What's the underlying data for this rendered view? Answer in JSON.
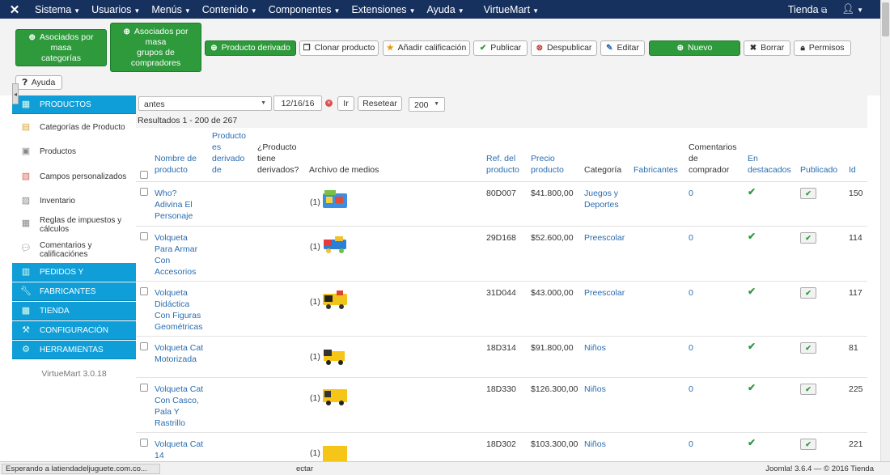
{
  "topnav": {
    "logo": "✕",
    "menus": [
      "Sistema",
      "Usuarios",
      "Menús",
      "Contenido",
      "Componentes",
      "Extensiones",
      "Ayuda"
    ],
    "virtuemart": "VirtueMart",
    "store": "Tienda",
    "user_icon": "user-icon"
  },
  "toolbar": {
    "mass_categories": [
      "Asociados por",
      "masa",
      "categorías"
    ],
    "mass_groups": [
      "Asociados por",
      "masa",
      "grupos de",
      "compradores"
    ],
    "derived": "Producto derivado",
    "clone": "Clonar producto",
    "rating": "Añadir calificación",
    "publish": "Publicar",
    "unpublish": "Despublicar",
    "edit": "Editar",
    "new": "Nuevo",
    "delete": "Borrar",
    "permissions": "Permisos",
    "help": "Ayuda"
  },
  "sidebar": {
    "products_header": "PRODUCTOS",
    "items": [
      "Categorías de Producto",
      "Productos",
      "Campos personalizados",
      "Inventario",
      "Reglas de impuestos y cálculos",
      "Comentarios y calificaciónes"
    ],
    "sections": [
      "PEDIDOS Y",
      "FABRICANTES",
      "TIENDA",
      "CONFIGURACIÓN",
      "HERRAMIENTAS"
    ],
    "version": "VirtueMart 3.0.18"
  },
  "filters": {
    "date_mode": "antes",
    "date_value": "12/16/16",
    "go": "Ir",
    "reset": "Resetear",
    "limit": "200"
  },
  "results": "Resultados 1 - 200 de 267",
  "table": {
    "headers": {
      "name": [
        "Nombre de",
        "producto"
      ],
      "derived_of": [
        "Producto",
        "es",
        "derivado",
        "de"
      ],
      "has_derived": [
        "¿Producto",
        "tiene",
        "derivados?"
      ],
      "media": "Archivo de medios",
      "sku": [
        "Ref. del",
        "producto"
      ],
      "price": [
        "Precio",
        "producto"
      ],
      "category": "Categoría",
      "manufacturers": "Fabricantes",
      "comments": [
        "Comentarios",
        "de",
        "comprador"
      ],
      "featured": [
        "En",
        "destacados"
      ],
      "published": "Publicado",
      "id": "Id"
    },
    "rows": [
      {
        "name": [
          "Who?",
          "Adivina El",
          "Personaje"
        ],
        "media": "(1)",
        "sku": "80D007",
        "price": "$41.800,00",
        "category": [
          "Juegos y",
          "Deportes"
        ],
        "comments": "0",
        "id": "150"
      },
      {
        "name": [
          "Volqueta",
          "Para Armar",
          "Con",
          "Accesorios"
        ],
        "media": "(1)",
        "sku": "29D168",
        "price": "$52.600,00",
        "category": [
          "Preescolar"
        ],
        "comments": "0",
        "id": "114"
      },
      {
        "name": [
          "Volqueta",
          "Didáctica",
          "Con Figuras",
          "Geométricas"
        ],
        "media": "(1)",
        "sku": "31D044",
        "price": "$43.000,00",
        "category": [
          "Preescolar"
        ],
        "comments": "0",
        "id": "117"
      },
      {
        "name": [
          "Volqueta Cat",
          "Motorizada"
        ],
        "media": "(1)",
        "sku": "18D314",
        "price": "$91.800,00",
        "category": [
          "Niños"
        ],
        "comments": "0",
        "id": "81"
      },
      {
        "name": [
          "Volqueta Cat",
          "Con Casco,",
          "Pala Y",
          "Rastrillo"
        ],
        "media": "(1)",
        "sku": "18D330",
        "price": "$126.300,00",
        "category": [
          "Niños"
        ],
        "comments": "0",
        "id": "225"
      },
      {
        "name": [
          "Volqueta Cat",
          "14"
        ],
        "media": "(1)",
        "sku": "18D302",
        "price": "$103.300,00",
        "category": [
          "Niños"
        ],
        "comments": "0",
        "id": "221"
      }
    ]
  },
  "statusbar": {
    "loading": "Esperando a latiendadeljuguete.com.co...",
    "mid": "ectar",
    "footer": "Joomla! 3.6.4 — © 2016 Tienda"
  }
}
